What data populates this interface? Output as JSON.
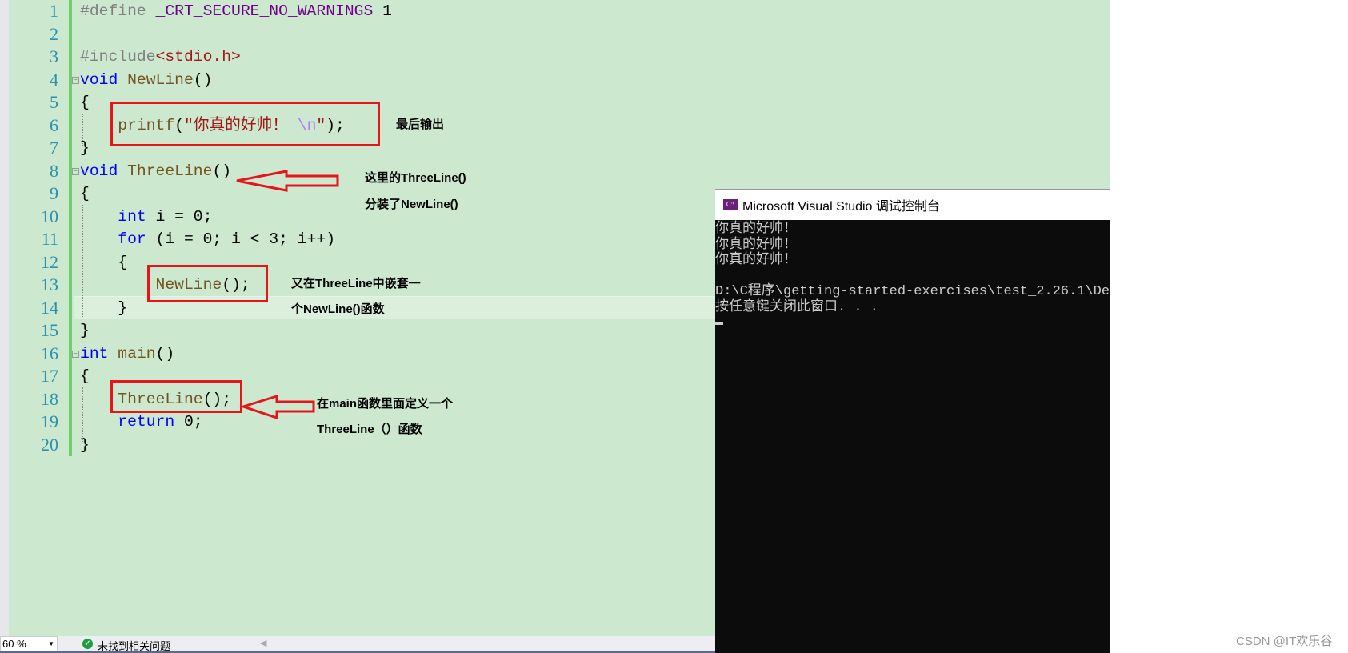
{
  "editor": {
    "lines": [
      {
        "n": "1",
        "tokens": [
          {
            "t": "#define",
            "c": "pp"
          },
          {
            "t": " "
          },
          {
            "t": "_CRT_SECURE_NO_WARNINGS",
            "c": "macro"
          },
          {
            "t": " 1"
          }
        ]
      },
      {
        "n": "2",
        "tokens": []
      },
      {
        "n": "3",
        "tokens": [
          {
            "t": "#include",
            "c": "pp"
          },
          {
            "t": "<stdio.h>",
            "c": "str"
          }
        ]
      },
      {
        "n": "4",
        "fold": true,
        "tokens": [
          {
            "t": "void",
            "c": "kw"
          },
          {
            "t": " "
          },
          {
            "t": "NewLine",
            "c": "fn"
          },
          {
            "t": "()"
          }
        ]
      },
      {
        "n": "5",
        "tokens": [
          {
            "t": "{"
          }
        ]
      },
      {
        "n": "6",
        "tokens": [
          {
            "t": "    "
          },
          {
            "t": "printf",
            "c": "fn"
          },
          {
            "t": "("
          },
          {
            "t": "\"你真的好帅！",
            "c": "str"
          },
          {
            "t": " \\n",
            "c": "esc"
          },
          {
            "t": "\"",
            "c": "str"
          },
          {
            "t": ");"
          }
        ]
      },
      {
        "n": "7",
        "tokens": [
          {
            "t": "}"
          }
        ]
      },
      {
        "n": "8",
        "fold": true,
        "tokens": [
          {
            "t": "void",
            "c": "kw"
          },
          {
            "t": " "
          },
          {
            "t": "ThreeLine",
            "c": "fn"
          },
          {
            "t": "()"
          }
        ]
      },
      {
        "n": "9",
        "tokens": [
          {
            "t": "{"
          }
        ]
      },
      {
        "n": "10",
        "tokens": [
          {
            "t": "    "
          },
          {
            "t": "int",
            "c": "kw"
          },
          {
            "t": " i = 0;"
          }
        ]
      },
      {
        "n": "11",
        "tokens": [
          {
            "t": "    "
          },
          {
            "t": "for",
            "c": "kw"
          },
          {
            "t": " (i = 0; i < 3; i++)"
          }
        ]
      },
      {
        "n": "12",
        "tokens": [
          {
            "t": "    {"
          }
        ]
      },
      {
        "n": "13",
        "tokens": [
          {
            "t": "        "
          },
          {
            "t": "NewLine",
            "c": "fn"
          },
          {
            "t": "();"
          }
        ]
      },
      {
        "n": "14",
        "tokens": [
          {
            "t": "    }"
          }
        ]
      },
      {
        "n": "15",
        "tokens": [
          {
            "t": "}"
          }
        ]
      },
      {
        "n": "16",
        "fold": true,
        "tokens": [
          {
            "t": "int",
            "c": "kw"
          },
          {
            "t": " "
          },
          {
            "t": "main",
            "c": "fn"
          },
          {
            "t": "()"
          }
        ]
      },
      {
        "n": "17",
        "tokens": [
          {
            "t": "{"
          }
        ]
      },
      {
        "n": "18",
        "tokens": [
          {
            "t": "    "
          },
          {
            "t": "ThreeLine",
            "c": "fn"
          },
          {
            "t": "();"
          }
        ]
      },
      {
        "n": "19",
        "tokens": [
          {
            "t": "    "
          },
          {
            "t": "return",
            "c": "kw"
          },
          {
            "t": " 0;"
          }
        ]
      },
      {
        "n": "20",
        "tokens": [
          {
            "t": "}"
          }
        ]
      }
    ],
    "current_line": "14"
  },
  "annotations": {
    "note1": "最后输出",
    "note2_line1": "这里的ThreeLine()",
    "note2_line2": "分装了NewLine()",
    "note3_line1": "又在ThreeLine中嵌套一",
    "note3_line2": "个NewLine()函数",
    "note4_line1": "在main函数里面定义一个",
    "note4_line2": "ThreeLine（）函数",
    "color": "#e8141c"
  },
  "console": {
    "title": "Microsoft Visual Studio 调试控制台",
    "icon": "console-app-icon",
    "lines": [
      "你真的好帅！",
      "你真的好帅！",
      "你真的好帅！",
      "",
      "D:\\C程序\\getting-started-exercises\\test_2.26.1\\De",
      "按任意键关闭此窗口. . ."
    ]
  },
  "status": {
    "zoom": "60 %",
    "issues": "未找到相关问题"
  },
  "watermark": "CSDN @IT欢乐谷",
  "colors": {
    "editor_bg": "#cce8cf",
    "keyword": "#0000ff",
    "function": "#74531f",
    "string": "#a31515",
    "macro": "#6f008a",
    "line_number": "#2b91af"
  }
}
